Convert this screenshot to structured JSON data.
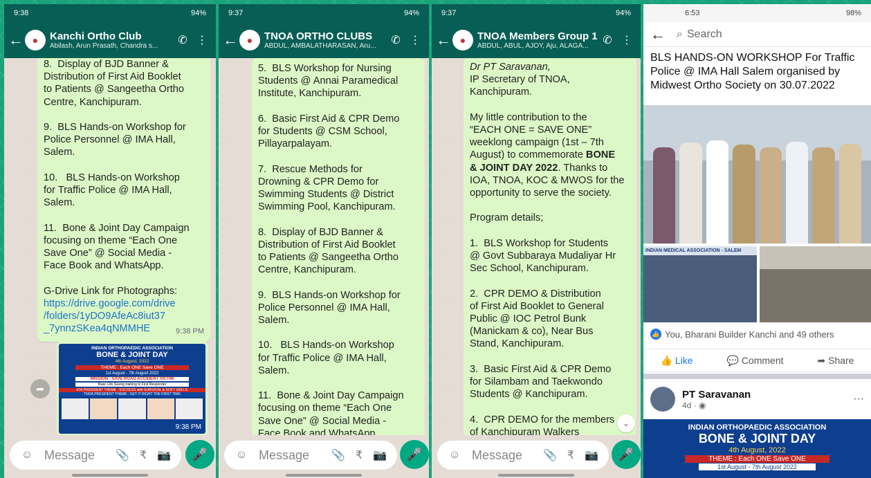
{
  "status": {
    "p1_time": "9:38",
    "p2_time": "9:37",
    "p3_time": "9:37",
    "p4_time": "6:53",
    "battery": "94%",
    "battery4": "98%"
  },
  "chats": [
    {
      "name": "Kanchi Ortho Club",
      "members": "Abilash, Arun Prasath, Chandra s...",
      "text": "8.  Display of BJD Banner &\nDistribution of First Aid Booklet\nto Patients @ Sangeetha Ortho\nCentre, Kanchipuram.\n\n9.  BLS Hands-on Workshop for\nPolice Personnel @ IMA Hall,\nSalem.\n\n10.   BLS Hands-on Workshop\nfor Traffic Police @ IMA Hall,\nSalem.\n\n11.  Bone & Joint Day Campaign\nfocusing on theme “Each One\nSave One” @ Social Media -\nFace Book and WhatsApp.\n\nG-Drive Link for Photographs:",
      "link": "https://drive.google.com/drive\n/folders/1yDO9AfeAc8iut37\n_7ynnzSKea4qNMMHE",
      "time": "9:38 PM",
      "img_time": "9:38 PM"
    },
    {
      "name": "TNOA ORTHO CLUBS",
      "members": "ABDUL, AMBALATHARASAN, Aru...",
      "text": "5.  BLS Workshop for Nursing\nStudents @ Annai Paramedical\nInstitute, Kanchipuram.\n\n6.  Basic First Aid & CPR Demo\nfor Students @ CSM School,\nPillayarpalayam.\n\n7.  Rescue Methods for\nDrowning & CPR Demo for\nSwimming Students @ District\nSwimming Pool, Kanchipuram.\n\n8.  Display of BJD Banner &\nDistribution of First Aid Booklet\nto Patients @ Sangeetha Ortho\nCentre, Kanchipuram.\n\n9.  BLS Hands-on Workshop for\nPolice Personnel @ IMA Hall,\nSalem.\n\n10.   BLS Hands-on Workshop\nfor Traffic Police @ IMA Hall,\nSalem.\n\n11.  Bone & Joint Day Campaign\nfocusing on theme “Each One\nSave One” @ Social Media -\nFace Book and WhatsApp."
    },
    {
      "name": "TNOA Members Group 1",
      "members": "ABDUL, ABUL, AJOY, Aju, ALAGA...",
      "sender": "Dr PT Saravanan,",
      "text_a": "IP Secretary of TNOA,\nKanchipuram.\n\nMy little contribution to the\n“EACH ONE = SAVE ONE”\nweeklong campaign (1st – 7th\nAugust) to commemorate ",
      "bold": "BONE\n& JOINT DAY 2022",
      "text_b": ". Thanks to\nIOA, TNOA, KOC & MWOS for the\nopportunity to serve the society.\n\nProgram details;\n\n1.  BLS Workshop for Students\n@ Govt Subbaraya Mudaliyar Hr\nSec School, Kanchipuram.\n\n2.  CPR DEMO & Distribution\nof First Aid Booklet to General\nPublic @ IOC Petrol Bunk\n(Manickam & co), Near Bus\nStand, Kanchipuram.\n\n3.  Basic First Aid & CPR Demo\nfor Silambam and Taekwondo\nStudents @ Kanchipuram.\n\n4.  CPR DEMO for the members\nof Kanchipuram Walkers"
    }
  ],
  "input_placeholder": "Message",
  "poster": {
    "org": "INDIAN ORTHOPAEDIC ASSOCIATION",
    "title": "BONE & JOINT DAY",
    "date": "4th August, 2022",
    "theme": "THEME : Each ONE Save ONE",
    "range": "1st August - 7th August 2022",
    "mission": "MISSION : SAVE ROAD ACCIDENT VICTIM",
    "mission_sub": "Basic Life Saving training to First Responder",
    "pres": "IOA PRESIDENT THEME : SUCCESS with SURGICAL & SOFT SKILLS",
    "tnoa": "TNOA PRESIDENT THEME : GET IT RIGHT THE FIRST TIME"
  },
  "fb": {
    "search": "Search",
    "post_title": "BLS HANDS-ON WORKSHOP For Traffic Police @ IMA Hall Salem organised by Midwest Ortho Society on 30.07.2022",
    "banner_text": "INDIAN MEDICAL ASSOCIATION - SALEM",
    "reactions": "You, Bharani Builder Kanchi and 49 others",
    "like": "Like",
    "comment": "Comment",
    "share": "Share",
    "author": "PT Saravanan",
    "age": "4d",
    "more": "···",
    "poster_org": "INDIAN ORTHOPAEDIC ASSOCIATION",
    "poster_title": "BONE & JOINT DAY",
    "poster_date": "4th August, 2022",
    "poster_theme": "THEME : Each ONE Save ONE",
    "poster_range": "1st August - 7th August 2022"
  }
}
